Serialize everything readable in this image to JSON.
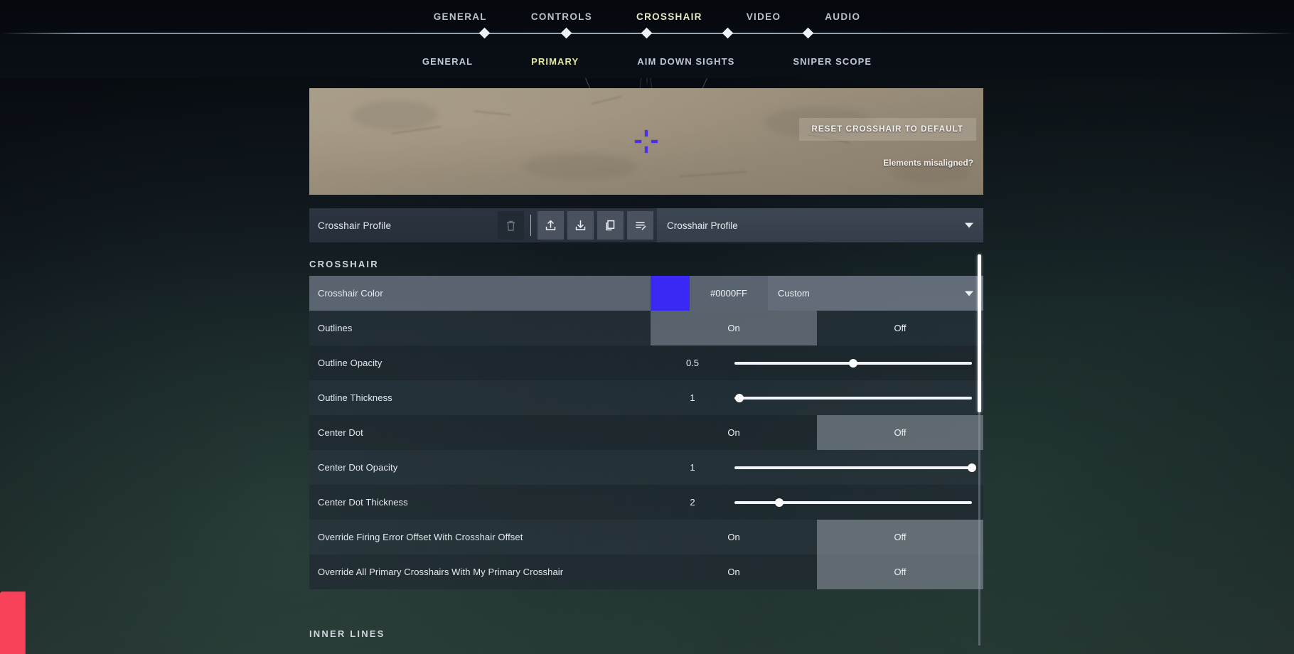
{
  "topnav": {
    "items": [
      {
        "label": "GENERAL",
        "active": false
      },
      {
        "label": "CONTROLS",
        "active": false
      },
      {
        "label": "CROSSHAIR",
        "active": true
      },
      {
        "label": "VIDEO",
        "active": false
      },
      {
        "label": "AUDIO",
        "active": false
      }
    ]
  },
  "subnav": {
    "items": [
      {
        "label": "GENERAL",
        "active": false
      },
      {
        "label": "PRIMARY",
        "active": true
      },
      {
        "label": "AIM DOWN SIGHTS",
        "active": false
      },
      {
        "label": "SNIPER SCOPE",
        "active": false
      }
    ]
  },
  "preview": {
    "reset_button": "RESET CROSSHAIR TO DEFAULT",
    "misaligned_link": "Elements misaligned?",
    "crosshair_color": "#4b2ef0"
  },
  "profile": {
    "label": "Crosshair Profile",
    "selected": "Crosshair Profile",
    "icons": [
      {
        "name": "trash-icon",
        "disabled": true
      },
      {
        "name": "export-icon",
        "disabled": false
      },
      {
        "name": "import-icon",
        "disabled": false
      },
      {
        "name": "duplicate-icon",
        "disabled": false
      },
      {
        "name": "rename-icon",
        "disabled": false
      }
    ]
  },
  "sections": {
    "crosshair_title": "CROSSHAIR",
    "inner_lines_title": "INNER LINES"
  },
  "settings": [
    {
      "label": "Crosshair Color",
      "type": "color",
      "swatch": "#3a28f5",
      "hex": "#0000FF",
      "mode": "Custom",
      "hovered": true
    },
    {
      "label": "Outlines",
      "type": "toggle",
      "on_label": "On",
      "off_label": "Off",
      "value": "On"
    },
    {
      "label": "Outline Opacity",
      "type": "slider",
      "value": "0.5",
      "percent": 50
    },
    {
      "label": "Outline Thickness",
      "type": "slider",
      "value": "1",
      "percent": 2
    },
    {
      "label": "Center Dot",
      "type": "toggle",
      "on_label": "On",
      "off_label": "Off",
      "value": "Off"
    },
    {
      "label": "Center Dot Opacity",
      "type": "slider",
      "value": "1",
      "percent": 100
    },
    {
      "label": "Center Dot Thickness",
      "type": "slider",
      "value": "2",
      "percent": 19
    },
    {
      "label": "Override Firing Error Offset With Crosshair Offset",
      "type": "toggle",
      "on_label": "On",
      "off_label": "Off",
      "value": "Off"
    },
    {
      "label": "Override All Primary Crosshairs With My Primary Crosshair",
      "type": "toggle",
      "on_label": "On",
      "off_label": "Off",
      "value": "Off"
    }
  ],
  "scrollbar": {
    "thumb_top": 1,
    "thumb_height": 222
  }
}
